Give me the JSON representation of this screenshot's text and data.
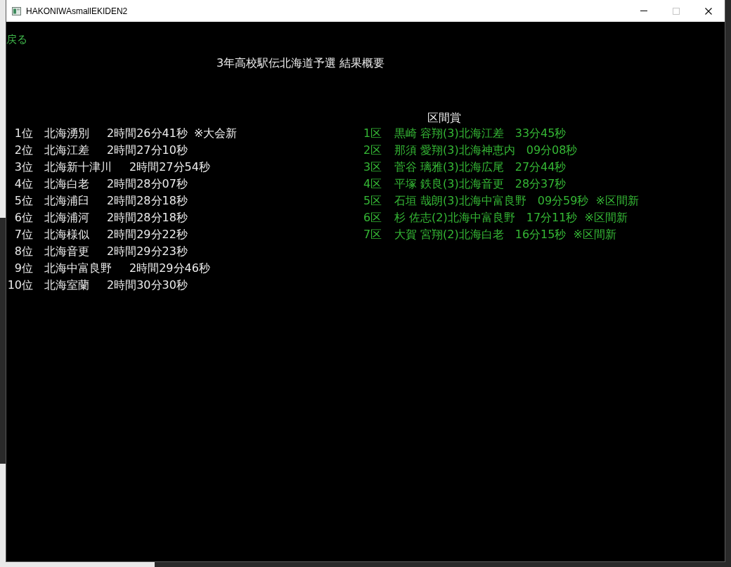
{
  "window": {
    "title": "HAKONIWAsmallEKIDEN2",
    "controls": [
      {
        "kind": "minimize",
        "disabled": false
      },
      {
        "kind": "maximize",
        "disabled": true
      },
      {
        "kind": "close",
        "disabled": false
      }
    ]
  },
  "back_link": "戻る",
  "heading": "3年高校駅伝北海道予選 結果概要",
  "results": [
    {
      "rank": "1位",
      "school": "北海湧別",
      "time": "2時間26分41秒",
      "note": "※大会新"
    },
    {
      "rank": "2位",
      "school": "北海江差",
      "time": "2時間27分10秒"
    },
    {
      "rank": "3位",
      "school": "北海新十津川",
      "time": "2時間27分54秒"
    },
    {
      "rank": "4位",
      "school": "北海白老",
      "time": "2時間28分07秒"
    },
    {
      "rank": "5位",
      "school": "北海浦臼",
      "time": "2時間28分18秒"
    },
    {
      "rank": "6位",
      "school": "北海浦河",
      "time": "2時間28分18秒"
    },
    {
      "rank": "7位",
      "school": "北海様似",
      "time": "2時間29分22秒"
    },
    {
      "rank": "8位",
      "school": "北海音更",
      "time": "2時間29分23秒"
    },
    {
      "rank": "9位",
      "school": "北海中富良野",
      "time": "2時間29分46秒"
    },
    {
      "rank": "10位",
      "school": "北海室蘭",
      "time": "2時間30分30秒"
    }
  ],
  "section_awards": {
    "title": "区間賞",
    "rows": [
      {
        "leg": "1区",
        "runner": "黒崎 容翔(3)北海江差",
        "time": "33分45秒"
      },
      {
        "leg": "2区",
        "runner": "那須 愛翔(3)北海神恵内",
        "time": "09分08秒"
      },
      {
        "leg": "3区",
        "runner": "菅谷 璃雅(3)北海広尾",
        "time": "27分44秒"
      },
      {
        "leg": "4区",
        "runner": "平塚 鉄良(3)北海音更",
        "time": "28分37秒"
      },
      {
        "leg": "5区",
        "runner": "石垣 哉朗(3)北海中富良野",
        "time": "09分59秒",
        "note": "※区間新"
      },
      {
        "leg": "6区",
        "runner": "杉 佐志(2)北海中富良野",
        "time": "17分11秒",
        "note": "※区間新"
      },
      {
        "leg": "7区",
        "runner": "大賀 宮翔(2)北海白老",
        "time": "16分15秒",
        "note": "※区間新"
      }
    ]
  }
}
